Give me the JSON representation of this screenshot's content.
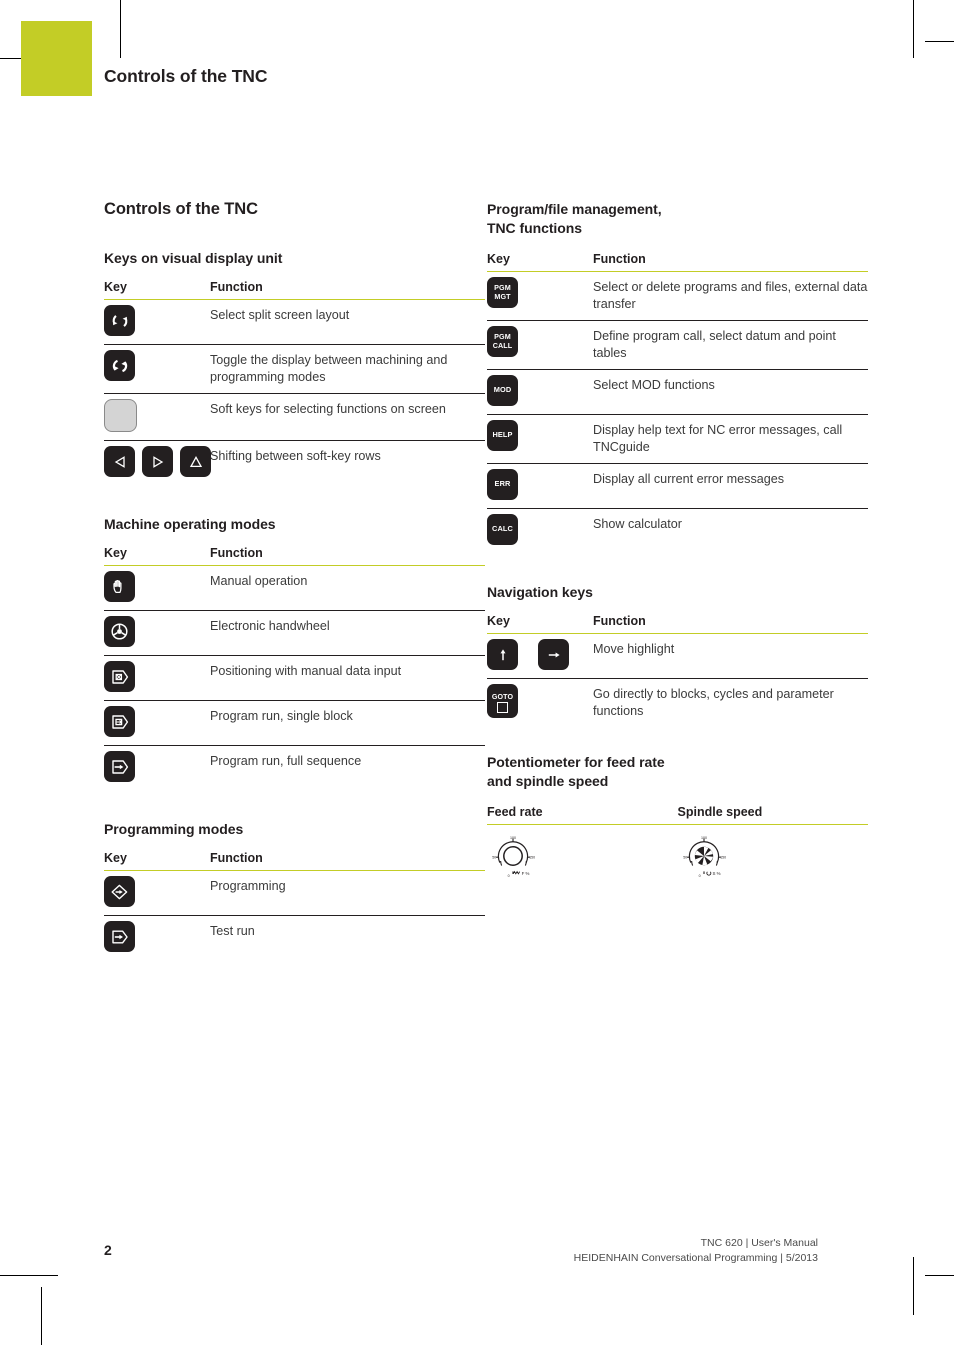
{
  "page": {
    "running_header": "Controls of the TNC",
    "folio": "2",
    "imprint_line1": "TNC 620 | User's Manual",
    "imprint_line2": "HEIDENHAIN Conversational Programming | 5/2013",
    "accent_color": "#c3cd26",
    "ink_color": "#231f20"
  },
  "left_column": {
    "section_title": "Controls of the TNC",
    "blocks": [
      {
        "title": "Keys on visual display unit",
        "headers": {
          "key": "Key",
          "function": "Function"
        },
        "rows": [
          {
            "icons": [
              "split-screen-key"
            ],
            "function": "Select split screen layout"
          },
          {
            "icons": [
              "toggle-display-key"
            ],
            "function": "Toggle the display between machining and programming modes"
          },
          {
            "icons": [
              "soft-key"
            ],
            "function": "Soft keys for selecting functions on screen"
          },
          {
            "icons": [
              "softkey-left-key",
              "softkey-right-key",
              "softkey-shift-key"
            ],
            "function": "Shifting between soft-key rows"
          }
        ]
      },
      {
        "title": "Machine operating modes",
        "headers": {
          "key": "Key",
          "function": "Function"
        },
        "rows": [
          {
            "icons": [
              "manual-operation-key"
            ],
            "function": "Manual operation"
          },
          {
            "icons": [
              "electronic-handwheel-key"
            ],
            "function": "Electronic handwheel"
          },
          {
            "icons": [
              "positioning-mdi-key"
            ],
            "function": "Positioning with manual data input"
          },
          {
            "icons": [
              "program-run-single-block-key"
            ],
            "function": "Program run, single block"
          },
          {
            "icons": [
              "program-run-full-sequence-key"
            ],
            "function": "Program run, full sequence"
          }
        ]
      },
      {
        "title": "Programming modes",
        "headers": {
          "key": "Key",
          "function": "Function"
        },
        "rows": [
          {
            "icons": [
              "programming-key"
            ],
            "function": "Programming"
          },
          {
            "icons": [
              "test-run-key"
            ],
            "function": "Test run"
          }
        ]
      }
    ]
  },
  "right_column": {
    "blocks": [
      {
        "title_line1": "Program/file management,",
        "title_line2": "TNC functions",
        "headers": {
          "key": "Key",
          "function": "Function"
        },
        "rows": [
          {
            "caps": [
              [
                "PGM",
                "MGT"
              ]
            ],
            "function": "Select or delete programs and files, external data transfer"
          },
          {
            "caps": [
              [
                "PGM",
                "CALL"
              ]
            ],
            "function": "Define program call, select datum and point tables"
          },
          {
            "caps": [
              [
                "MOD"
              ]
            ],
            "function": "Select MOD functions"
          },
          {
            "caps": [
              [
                "HELP"
              ]
            ],
            "function": "Display help text for NC error messages, call TNCguide"
          },
          {
            "caps": [
              [
                "ERR"
              ]
            ],
            "function": "Display all current error messages"
          },
          {
            "caps": [
              [
                "CALC"
              ]
            ],
            "function": "Show calculator"
          }
        ]
      },
      {
        "title": "Navigation keys",
        "headers": {
          "key": "Key",
          "function": "Function"
        },
        "rows": [
          {
            "icons": [
              "arrow-up-key",
              "arrow-left-key"
            ],
            "function": "Move highlight"
          },
          {
            "goto_label": "GOTO",
            "function": "Go directly to blocks, cycles and parameter functions"
          }
        ]
      },
      {
        "title_line1": "Potentiometer for feed rate",
        "title_line2": "and spindle speed",
        "headers": {
          "feed": "Feed rate",
          "spindle": "Spindle speed"
        },
        "feed_dial": {
          "name": "feed-rate-potentiometer",
          "ticks": [
            "50",
            "150",
            "0"
          ],
          "unit": "F %"
        },
        "spindle_dial": {
          "name": "spindle-speed-potentiometer",
          "ticks": [
            "50",
            "150",
            "0"
          ],
          "unit": "S %"
        }
      }
    ]
  }
}
